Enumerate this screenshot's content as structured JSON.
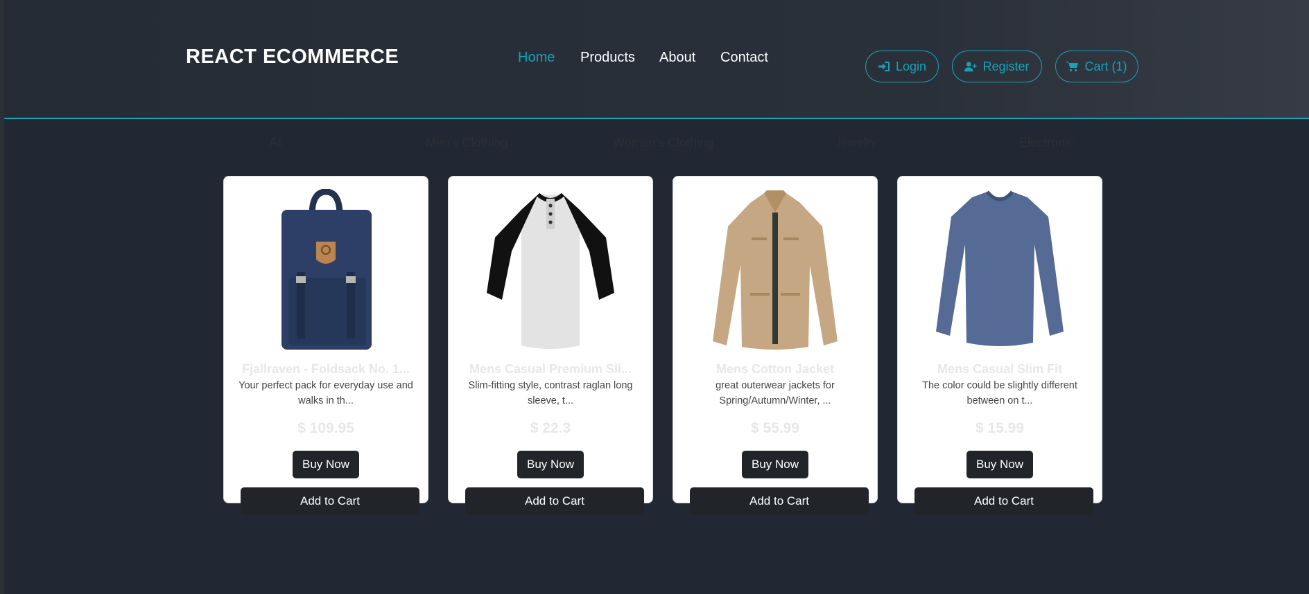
{
  "header": {
    "brand": "REACT ECOMMERCE",
    "nav": [
      {
        "label": "Home",
        "active": true
      },
      {
        "label": "Products",
        "active": false
      },
      {
        "label": "About",
        "active": false
      },
      {
        "label": "Contact",
        "active": false
      }
    ],
    "buttons": {
      "login": {
        "label": "Login",
        "icon": "sign-in-icon"
      },
      "register": {
        "label": "Register",
        "icon": "user-plus-icon"
      },
      "cart": {
        "label": "Cart (1)",
        "icon": "shopping-cart-icon"
      }
    }
  },
  "filters": [
    "All",
    "Men's Clothing",
    "Women's Clothing",
    "Jewelry",
    "Electronic"
  ],
  "products": [
    {
      "title": "Fjallraven - Foldsack No. 1...",
      "description": "Your perfect pack for everyday use and walks in th...",
      "price": "$ 109.95",
      "image_icon": "backpack-image",
      "buy_label": "Buy Now",
      "cart_label": "Add to Cart"
    },
    {
      "title": "Mens Casual Premium Sli...",
      "description": "Slim-fitting style, contrast raglan long sleeve, t...",
      "price": "$ 22.3",
      "image_icon": "raglan-shirt-image",
      "buy_label": "Buy Now",
      "cart_label": "Add to Cart"
    },
    {
      "title": "Mens Cotton Jacket",
      "description": "great outerwear jackets for Spring/Autumn/Winter, ...",
      "price": "$ 55.99",
      "image_icon": "jacket-image",
      "buy_label": "Buy Now",
      "cart_label": "Add to Cart"
    },
    {
      "title": "Mens Casual Slim Fit",
      "description": "The color could be slightly different between on t...",
      "price": "$ 15.99",
      "image_icon": "long-sleeve-shirt-image",
      "buy_label": "Buy Now",
      "cart_label": "Add to Cart"
    }
  ],
  "colors": {
    "accent": "#17a2b8",
    "background": "#222833",
    "button_dark": "#212529"
  }
}
